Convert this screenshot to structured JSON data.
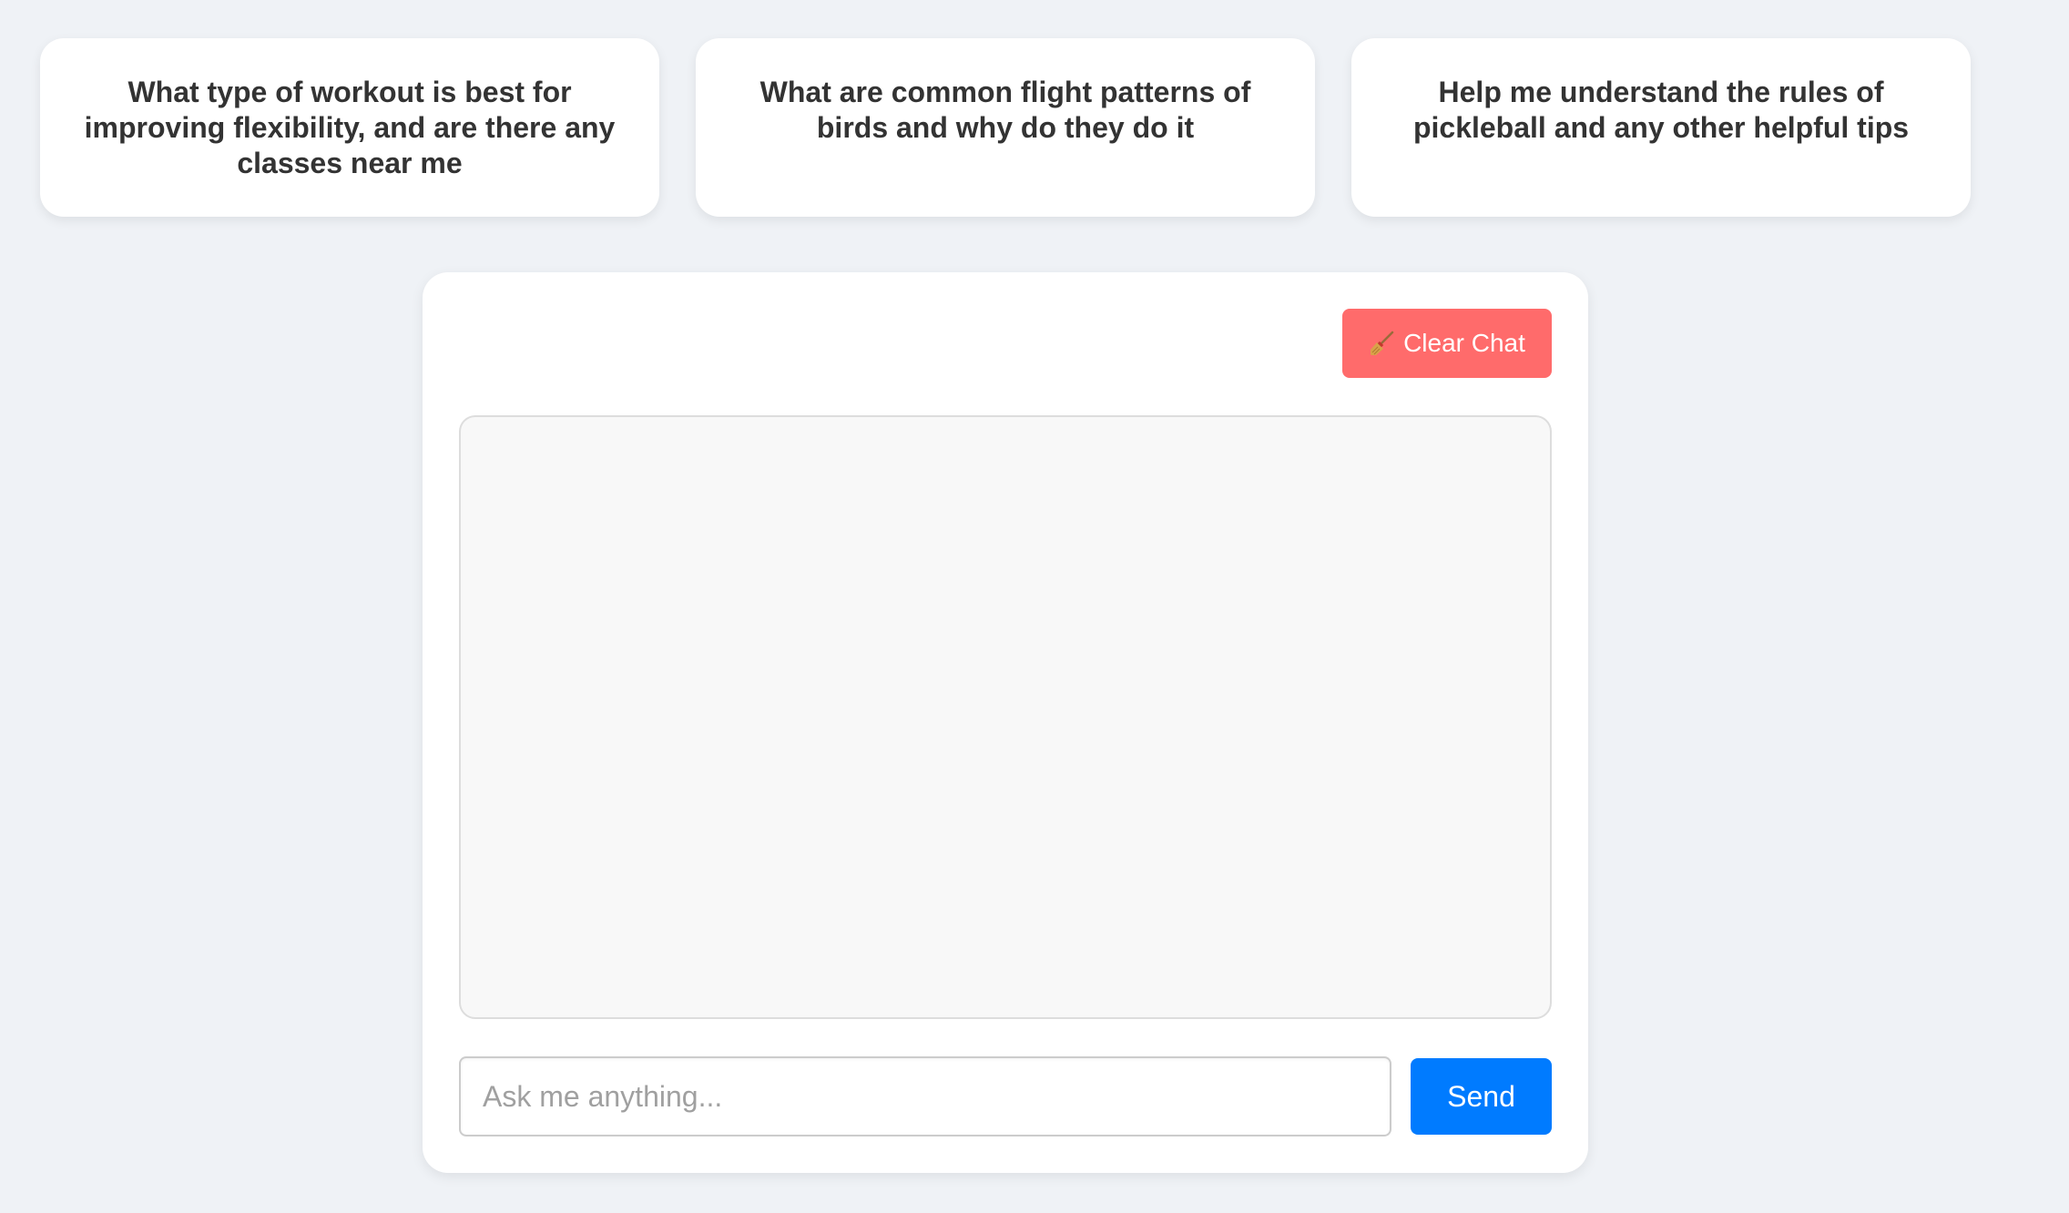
{
  "suggestions": [
    {
      "text": "What type of workout is best for improving flexibility, and are there any classes near me"
    },
    {
      "text": "What are common flight patterns of birds and why do they do it"
    },
    {
      "text": "Help me understand the rules of pickleball and any other helpful tips"
    }
  ],
  "chat": {
    "clear_label": "Clear Chat",
    "clear_icon": "broom-icon",
    "input_placeholder": "Ask me anything...",
    "input_value": "",
    "send_label": "Send"
  },
  "colors": {
    "page_background": "#eff2f6",
    "clear_button": "#ff6b6b",
    "send_button": "#007bff",
    "messages_background": "#f8f8f8"
  }
}
